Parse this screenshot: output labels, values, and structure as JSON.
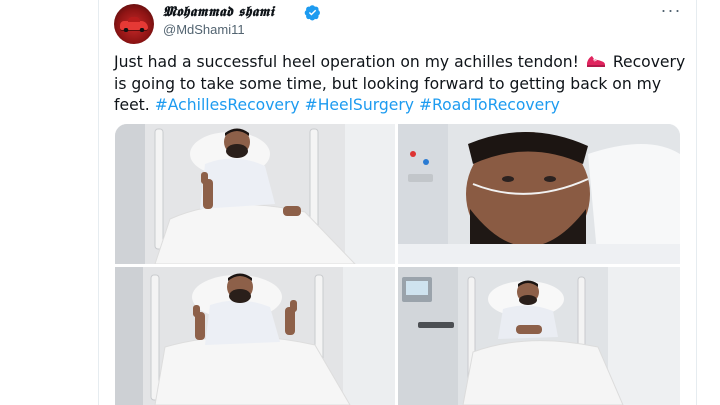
{
  "tweet": {
    "author": {
      "display_name": "𝕸𝖔𝖍𝖆𝖒𝖒𝖆𝖉 𝖘𝖍𝖆𝖒𝖎",
      "handle": "@MdShami11",
      "verified_icon": "verified-badge-icon",
      "avatar_icon": "red-car-avatar"
    },
    "more_label": "···",
    "text_part1": "Just had a successful heel operation on my achilles tendon! ",
    "text_emoji_icon": "running-shoe-icon",
    "text_part2": " Recovery is going to take some time, but looking forward to getting back on my feet. ",
    "hashtags": [
      "#AchillesRecovery",
      "#HeelSurgery",
      "#RoadToRecovery"
    ],
    "media": [
      {
        "name": "photo-thumbs-up-in-bed"
      },
      {
        "name": "photo-selfie-with-oxygen-tube"
      },
      {
        "name": "photo-double-thumbs-up"
      },
      {
        "name": "photo-lying-in-hospital-bed"
      }
    ]
  },
  "colors": {
    "accent": "#1d9bf0",
    "text": "#0f1419",
    "secondary_text": "#536471",
    "border": "#e6ecf0",
    "shoe": "#e0245e"
  }
}
